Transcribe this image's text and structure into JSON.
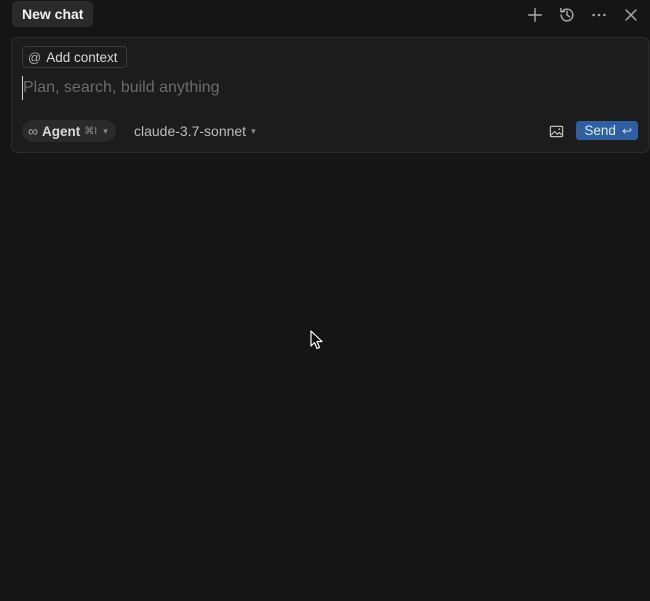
{
  "header": {
    "tab_title": "New chat",
    "actions": [
      {
        "name": "new-chat-icon",
        "label": "plus"
      },
      {
        "name": "history-icon",
        "label": "history"
      },
      {
        "name": "more-icon",
        "label": "more"
      },
      {
        "name": "close-icon",
        "label": "close"
      }
    ]
  },
  "composer": {
    "context_button": {
      "symbol": "@",
      "label": "Add context"
    },
    "input": {
      "value": "",
      "placeholder": "Plan, search, build anything"
    },
    "mode": {
      "icon": "infinity-icon",
      "label": "Agent",
      "shortcut": "⌘I"
    },
    "model": {
      "label": "claude-3.7-sonnet"
    },
    "image_button": {
      "icon": "image-icon"
    },
    "send_button": {
      "label": "Send",
      "enter_symbol": "↩"
    }
  },
  "colors": {
    "background": "#151515",
    "composer_bg": "#1c1c1c",
    "accent": "#2e5fa0"
  }
}
